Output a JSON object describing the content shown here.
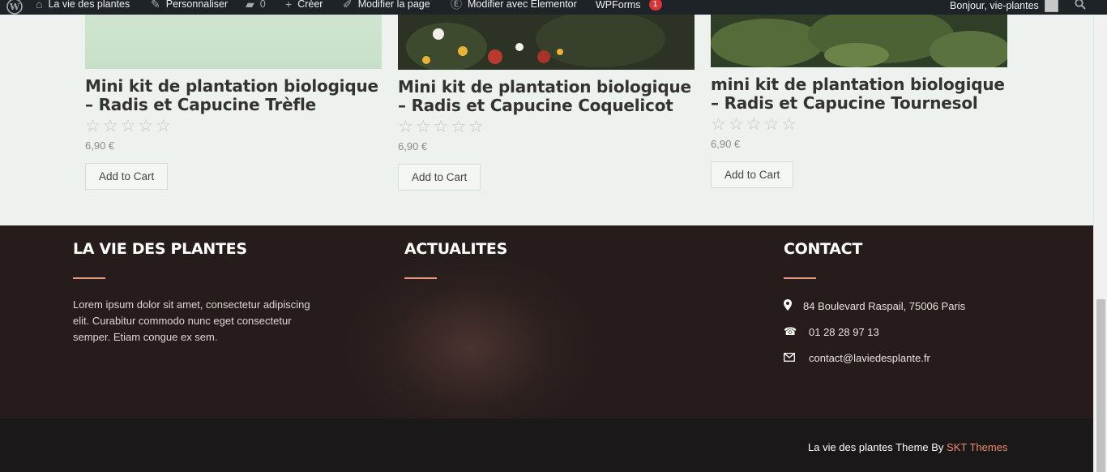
{
  "admin_bar": {
    "site_name": "La vie des plantes",
    "customize": "Personnaliser",
    "comments_count": "0",
    "new": "Créer",
    "edit_page": "Modifier la page",
    "edit_elementor": "Modifier avec Elementor",
    "wpforms": "WPForms",
    "wpforms_badge": "1",
    "greeting": "Bonjour, vie-plantes"
  },
  "products": [
    {
      "title": "Mini kit de plantation biologique – Radis et Capucine Trèfle",
      "stars": "☆☆☆☆☆",
      "price": "6,90 €",
      "button": "Add to Cart"
    },
    {
      "title": "Mini kit de plantation biologique – Radis et Capucine Coquelicot",
      "stars": "☆☆☆☆☆",
      "price": "6,90 €",
      "button": "Add to Cart"
    },
    {
      "title": "mini kit de plantation biologique – Radis et Capucine Tournesol",
      "stars": "☆☆☆☆☆",
      "price": "6,90 €",
      "button": "Add to Cart"
    }
  ],
  "footer": {
    "about_title": "LA VIE DES PLANTES",
    "about_text": "Lorem ipsum dolor sit amet, consectetur adipiscing elit. Curabitur commodo nunc eget consectetur semper. Etiam congue ex sem.",
    "news_title": "ACTUALITES",
    "contact_title": "CONTACT",
    "address": "84 Boulevard Raspail, 75006 Paris",
    "phone": "01 28 28 97 13",
    "email": "contact@laviedesplante.fr"
  },
  "credits": {
    "text": "La vie des plantes Theme By ",
    "link": "SKT Themes"
  },
  "colors": {
    "accent": "#ee8d6b",
    "footer_bg": "#2d211f",
    "bottom_bg": "#1a1819",
    "admin_bg": "#1d2327"
  }
}
